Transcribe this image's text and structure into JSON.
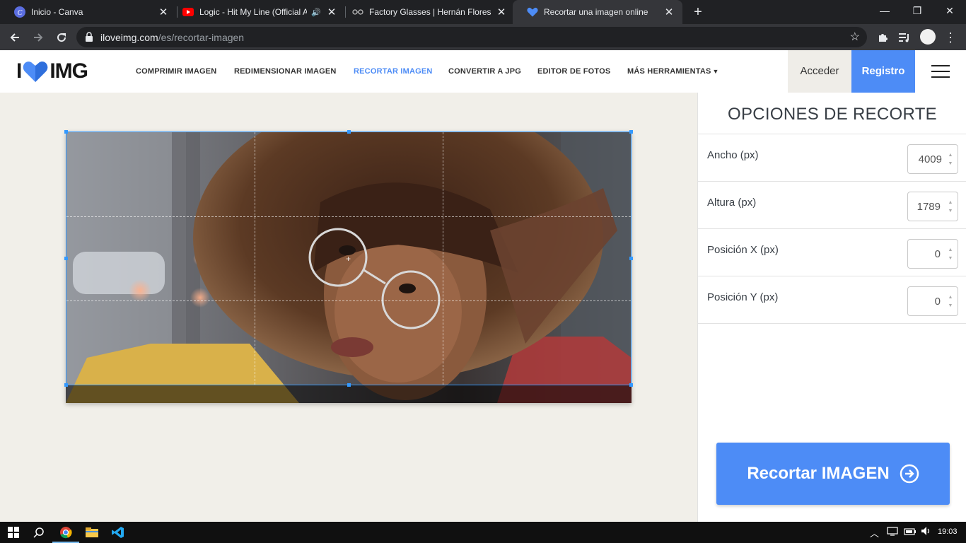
{
  "browser": {
    "tabs": [
      {
        "title": "Inicio - Canva",
        "favicon": "canva-icon"
      },
      {
        "title": "Logic - Hit My Line (Official A",
        "favicon": "youtube-icon",
        "audio": true
      },
      {
        "title": "Factory Glasses | Hernán Flores",
        "favicon": "glasses-icon"
      },
      {
        "title": "Recortar una imagen online",
        "favicon": "iloveimg-heart-icon",
        "active": true
      }
    ],
    "url_host": "iloveimg.com",
    "url_path": "/es/recortar-imagen"
  },
  "site": {
    "logo_left": "I",
    "logo_right": "IMG",
    "nav": [
      {
        "label": "COMPRIMIR IMAGEN"
      },
      {
        "label": "REDIMENSIONAR IMAGEN"
      },
      {
        "label": "RECORTAR IMAGEN",
        "active": true
      },
      {
        "label": "CONVERTIR A JPG"
      },
      {
        "label": "EDITOR DE FOTOS"
      },
      {
        "label": "MÁS HERRAMIENTAS"
      }
    ],
    "login_label": "Acceder",
    "register_label": "Registro",
    "accent_color": "#4d8cf6"
  },
  "sidebar": {
    "title": "OPCIONES DE RECORTE",
    "options": [
      {
        "label": "Ancho (px)",
        "value": "4009"
      },
      {
        "label": "Altura (px)",
        "value": "1789"
      },
      {
        "label": "Posición X (px)",
        "value": "0"
      },
      {
        "label": "Posición Y (px)",
        "value": "0"
      }
    ],
    "action_label": "Recortar IMAGEN"
  },
  "taskbar": {
    "clock": "19:03"
  }
}
